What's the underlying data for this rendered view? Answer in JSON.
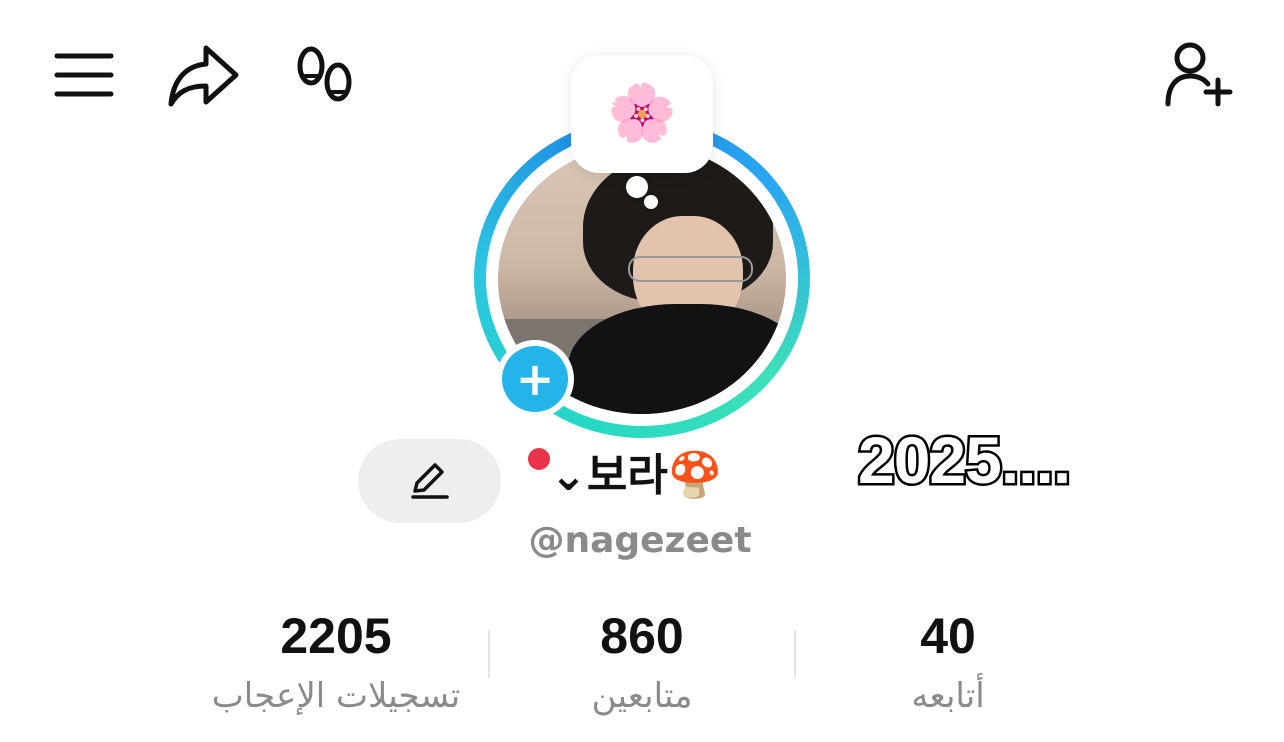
{
  "topbar": {
    "menu_icon": "hamburger-menu-icon",
    "share_icon": "share-arrow-icon",
    "footprints_icon": "footprints-icon",
    "add_friend_icon": "add-user-icon"
  },
  "profile": {
    "status_emoji": "🌸",
    "name_prefix": "⌄",
    "name": "보라",
    "name_suffix_emoji": "🍄",
    "handle": "@nagezeet",
    "overlay_text": "2025....",
    "edit_icon": "pencil-icon",
    "add_story_icon": "plus-icon"
  },
  "stats": [
    {
      "value": "2205",
      "label": "تسجيلات الإعجاب"
    },
    {
      "value": "860",
      "label": "متابعين"
    },
    {
      "value": "40",
      "label": "أتابعه"
    }
  ],
  "colors": {
    "ring_accent": "#26d8c4",
    "ring_blue": "#1e88e5",
    "add_badge": "#25b4ea",
    "name_dot": "#e8334a",
    "muted_text": "#8a8a8a"
  }
}
